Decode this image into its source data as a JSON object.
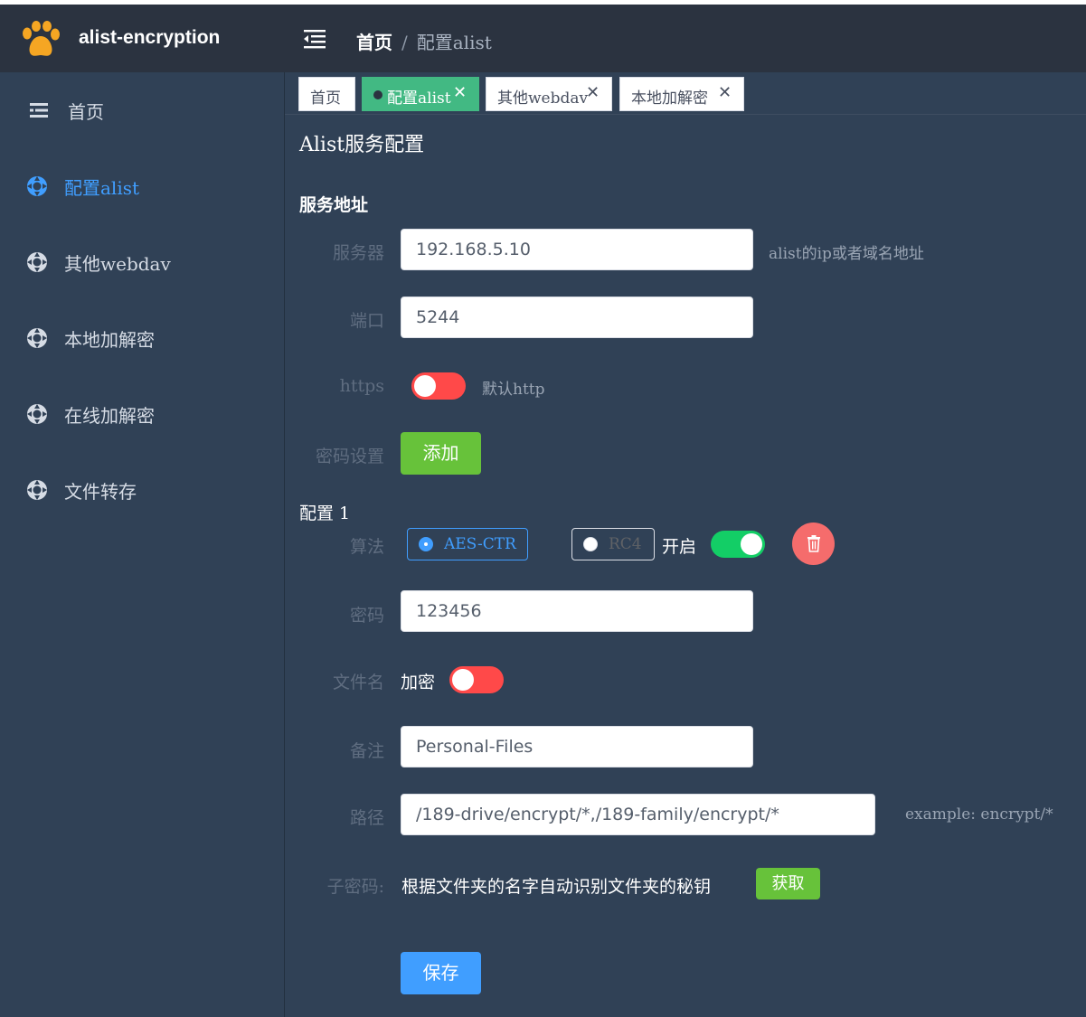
{
  "colors": {
    "header_bg": "#2b3340",
    "sidebar_bg": "#304156",
    "active_menu": "#409eff",
    "tab_active": "#42b983",
    "switch_on": "#13ce66",
    "switch_off": "#ff4949",
    "btn_green": "#67c23a",
    "btn_blue": "#409eff",
    "danger": "#f56c6c"
  },
  "header": {
    "app_title": "alist-encryption",
    "logo_icon": "paw-icon",
    "collapse_icon": "menu-fold-icon",
    "breadcrumb_home": "首页",
    "breadcrumb_sep": "/",
    "breadcrumb_current": "配置alist"
  },
  "sidebar": {
    "items": [
      {
        "label": "首页",
        "icon": "menu-icon",
        "active": false
      },
      {
        "label": "配置alist",
        "icon": "lifebuoy-icon",
        "active": true
      },
      {
        "label": "其他webdav",
        "icon": "lifebuoy-icon",
        "active": false
      },
      {
        "label": "本地加解密",
        "icon": "lifebuoy-icon",
        "active": false
      },
      {
        "label": "在线加解密",
        "icon": "lifebuoy-icon",
        "active": false
      },
      {
        "label": "文件转存",
        "icon": "lifebuoy-icon",
        "active": false
      }
    ]
  },
  "tabs": [
    {
      "label": "首页",
      "closable": false,
      "active": false
    },
    {
      "label": "配置alist",
      "closable": true,
      "active": true
    },
    {
      "label": "其他webdav",
      "closable": true,
      "active": false
    },
    {
      "label": "本地加解密",
      "closable": true,
      "active": false
    }
  ],
  "tab_close": "✕",
  "page": {
    "title": "Alist服务配置",
    "section_title": "服务地址",
    "server_label": "服务器",
    "server_value": "192.168.5.10",
    "server_hint": "alist的ip或者域名地址",
    "port_label": "端口",
    "port_value": "5244",
    "https_label": "https",
    "https_on": false,
    "https_hint": "默认http",
    "password_settings_label": "密码设置",
    "add_button": "添加",
    "config_title": "配置 1",
    "algo_label": "算法",
    "algo_option_1": "AES-CTR",
    "algo_option_2": "RC4",
    "algo_selected": "AES-CTR",
    "enable_label": "开启",
    "enable_on": true,
    "delete_icon": "trash-icon",
    "password_label": "密码",
    "password_value": "123456",
    "filename_label": "文件名",
    "filename_encrypt_label": "加密",
    "filename_encrypt_on": false,
    "note_label": "备注",
    "note_value": "Personal-Files",
    "path_label": "路径",
    "path_value": "/189-drive/encrypt/*,/189-family/encrypt/*",
    "path_hint": "example: encrypt/*",
    "subkey_label": "子密码:",
    "subkey_desc": "根据文件夹的名字自动识别文件夹的秘钥",
    "fetch_button": "获取",
    "save_button": "保存"
  }
}
